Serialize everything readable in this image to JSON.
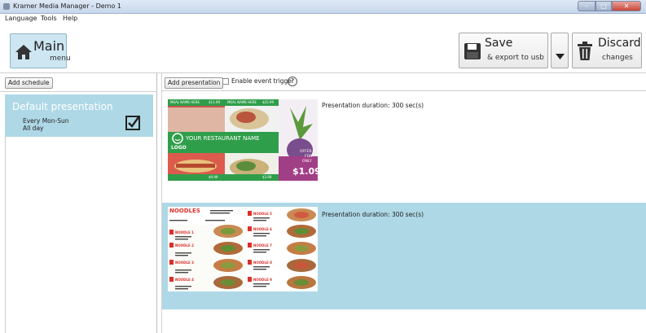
{
  "window": {
    "title": "Kramer Media Manager - Demo 1"
  },
  "menu": {
    "items": [
      "Language",
      "Tools",
      "Help"
    ]
  },
  "toolbar": {
    "main_title": "Main",
    "main_sub": "menu",
    "save_title": "Save",
    "save_sub": "& export to usb",
    "discard_title": "Discard",
    "discard_sub": "changes"
  },
  "left": {
    "add_schedule": "Add schedule",
    "schedule": {
      "title": "Default presentation",
      "days": "Every Mon-Sun",
      "time": "All day"
    }
  },
  "right": {
    "add_presentation": "Add presentation",
    "event_trigger": "Enable event trigger",
    "help": "?",
    "presentations": [
      {
        "duration": "Presentation duration: 300 sec(s)",
        "thumb": {
          "restaurant_name": "YOUR RESTAURANT NAME",
          "logo": "LOGO",
          "offer": "OFFER",
          "for": "FOR",
          "only": "ONLY",
          "price": "$1.09",
          "p1": "$11.99",
          "p2": "$25.99",
          "p3": "$9.99",
          "p4": "$3.99",
          "meal1": "MEAL NAME HERE",
          "meal2": "MEAL NAME HERE"
        }
      },
      {
        "duration": "Presentation duration: 300 sec(s)",
        "thumb": {
          "title": "NOODLES",
          "n1": "NOODLE 1",
          "n2": "NOODLE 2",
          "n3": "NOODLE 3",
          "n4": "NOODLE 4",
          "n5": "NOODLE 5",
          "n6": "NOODLE 6",
          "n7": "NOODLE 7",
          "n8": "NOODLE 8",
          "n9": "NOODLE 9"
        }
      }
    ]
  },
  "colors": {
    "accent": "#aed8e6",
    "green": "#2f9e4a",
    "red": "#d8312a"
  }
}
